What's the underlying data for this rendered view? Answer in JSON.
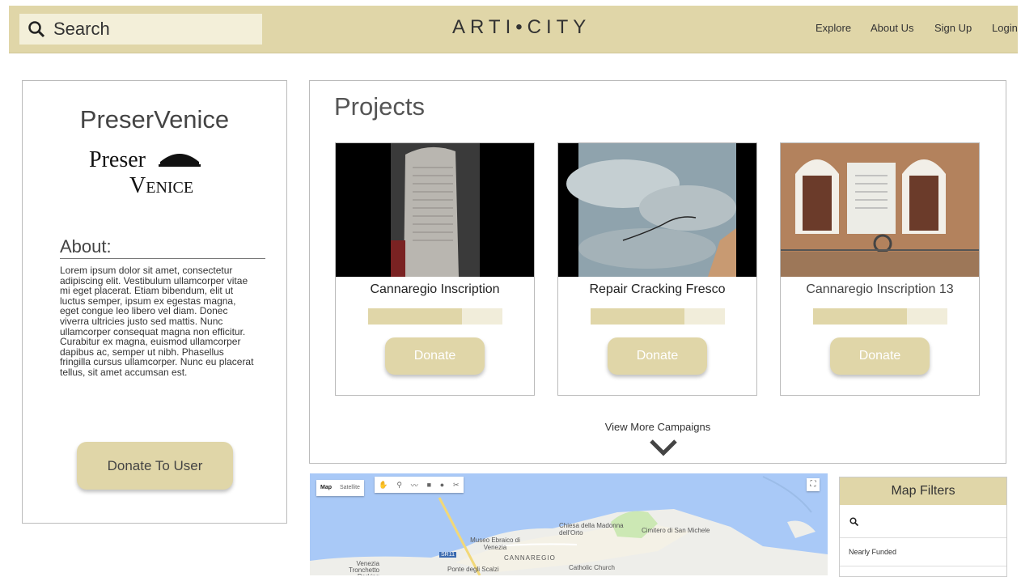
{
  "header": {
    "search_placeholder": "Search",
    "brand": "ARTI•CITY",
    "nav": [
      "Explore",
      "About Us",
      "Sign Up",
      "Login"
    ]
  },
  "profile": {
    "name": "PreserVenice",
    "logo_text_top": "Preser",
    "logo_text_bottom": "Venice",
    "about_heading": "About:",
    "about_text": "Lorem ipsum dolor sit amet, consectetur adipiscing elit. Vestibulum ullamcorper vitae mi eget placerat. Etiam bibendum, elit ut luctus semper, ipsum ex egestas magna, eget congue leo libero vel diam. Donec viverra ultricies justo sed mattis. Nunc ullamcorper consequat magna non efficitur. Curabitur ex magna, euismod ullamcorper dapibus ac, semper ut nibh. Phasellus fringilla cursus ullamcorper. Nunc eu placerat tellus, sit amet accumsan est.",
    "donate_label": "Donate To User"
  },
  "projects": {
    "heading": "Projects",
    "cards": [
      {
        "title": "Cannaregio Inscription",
        "progress": 0.7,
        "donate_label": "Donate"
      },
      {
        "title": "Repair Cracking Fresco",
        "progress": 0.7,
        "donate_label": "Donate"
      },
      {
        "title": "Cannaregio Inscription 13",
        "progress": 0.7,
        "donate_label": "Donate"
      }
    ],
    "view_more": "View More Campaigns"
  },
  "map": {
    "tabs": [
      "Map",
      "Satellite"
    ],
    "labels": [
      "Chiesa della Madonna dell'Orto",
      "Cimitero di San Michele",
      "Museo Ebraico di Venezia",
      "CANNAREGIO",
      "SR11",
      "Venezia Tronchetto Parking",
      "Ponte degli Scalzi",
      "Catholic Church"
    ]
  },
  "filters": {
    "heading": "Map Filters",
    "items": [
      "Nearly Funded"
    ]
  },
  "colors": {
    "accent": "#e0d6a8",
    "accent_light": "#f1edda",
    "map_water": "#a9c9f7",
    "map_land": "#eeeeea"
  }
}
